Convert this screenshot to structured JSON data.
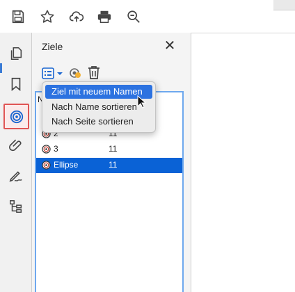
{
  "panel": {
    "title": "Ziele",
    "list_header": "N"
  },
  "context_menu": {
    "items": [
      {
        "label": "Ziel mit neuem Namen"
      },
      {
        "label": "Nach Name sortieren"
      },
      {
        "label": "Nach Seite sortieren"
      }
    ]
  },
  "destinations": [
    {
      "name": "2",
      "page": "11"
    },
    {
      "name": "3",
      "page": "11"
    },
    {
      "name": "Ellipse",
      "page": "11",
      "selected": true
    }
  ],
  "colors": {
    "selection": "#0a62d6",
    "menu_highlight": "#2c72e0",
    "active_rail_border": "#e05555",
    "list_focus_border": "#6ea8ee"
  }
}
